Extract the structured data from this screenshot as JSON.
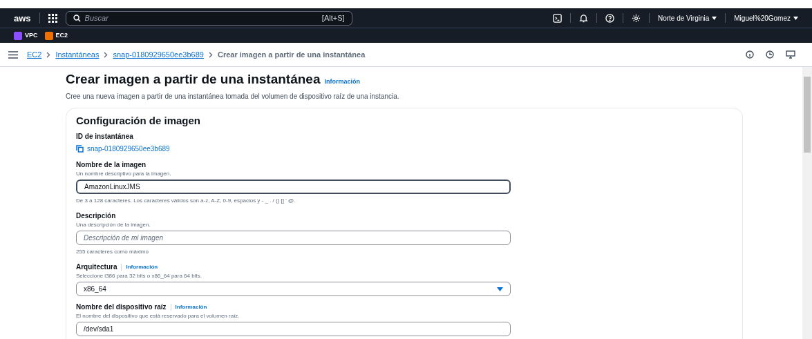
{
  "topbar": {
    "logo": "aws",
    "search": {
      "placeholder": "Buscar",
      "shortcut": "[Alt+S]"
    },
    "region": "Norte de Virginia",
    "user": "Miguel%20Gomez"
  },
  "favorites": [
    {
      "label": "VPC",
      "color": "#8c4fff"
    },
    {
      "label": "EC2",
      "color": "#ed7100"
    }
  ],
  "breadcrumbs": [
    {
      "label": "EC2",
      "link": true
    },
    {
      "label": "Instantáneas",
      "link": true
    },
    {
      "label": "snap-0180929650ee3b689",
      "link": true
    },
    {
      "label": "Crear imagen a partir de una instantánea",
      "link": false
    }
  ],
  "page": {
    "title": "Crear imagen a partir de una instantánea",
    "info": "Información",
    "description": "Cree una nueva imagen a partir de una instantánea tomada del volumen de dispositivo raíz de una instancia."
  },
  "panel": {
    "title": "Configuración de imagen",
    "fields": [
      {
        "kind": "copy",
        "label": "ID de instantánea",
        "value": "snap-0180929650ee3b689"
      },
      {
        "kind": "text",
        "label": "Nombre de la imagen",
        "description": "Un nombre descriptivo para la imagen.",
        "value": "AmazonLinuxJMS",
        "focused": true,
        "constraint": "De 3 a 128 caracteres. Los caracteres válidos son a-z, A-Z, 0-9, espacios y - _ . / () [] ' @."
      },
      {
        "kind": "text",
        "label": "Descripción",
        "description": "Una descripción de la imagen.",
        "placeholder": "Descripción de mi imagen",
        "focused": false,
        "constraint": "255 caracteres como máximo"
      },
      {
        "kind": "select",
        "label": "Arquitectura",
        "info": "Información",
        "description": "Seleccione i386 para 32 bits o x86_64 para 64 bits.",
        "value": "x86_64"
      },
      {
        "kind": "text",
        "label": "Nombre del dispositivo raíz",
        "info": "Información",
        "description": "El nombre del dispositivo que está reservado para el volumen raíz.",
        "value": "/dev/sda1",
        "focused": false
      }
    ]
  }
}
